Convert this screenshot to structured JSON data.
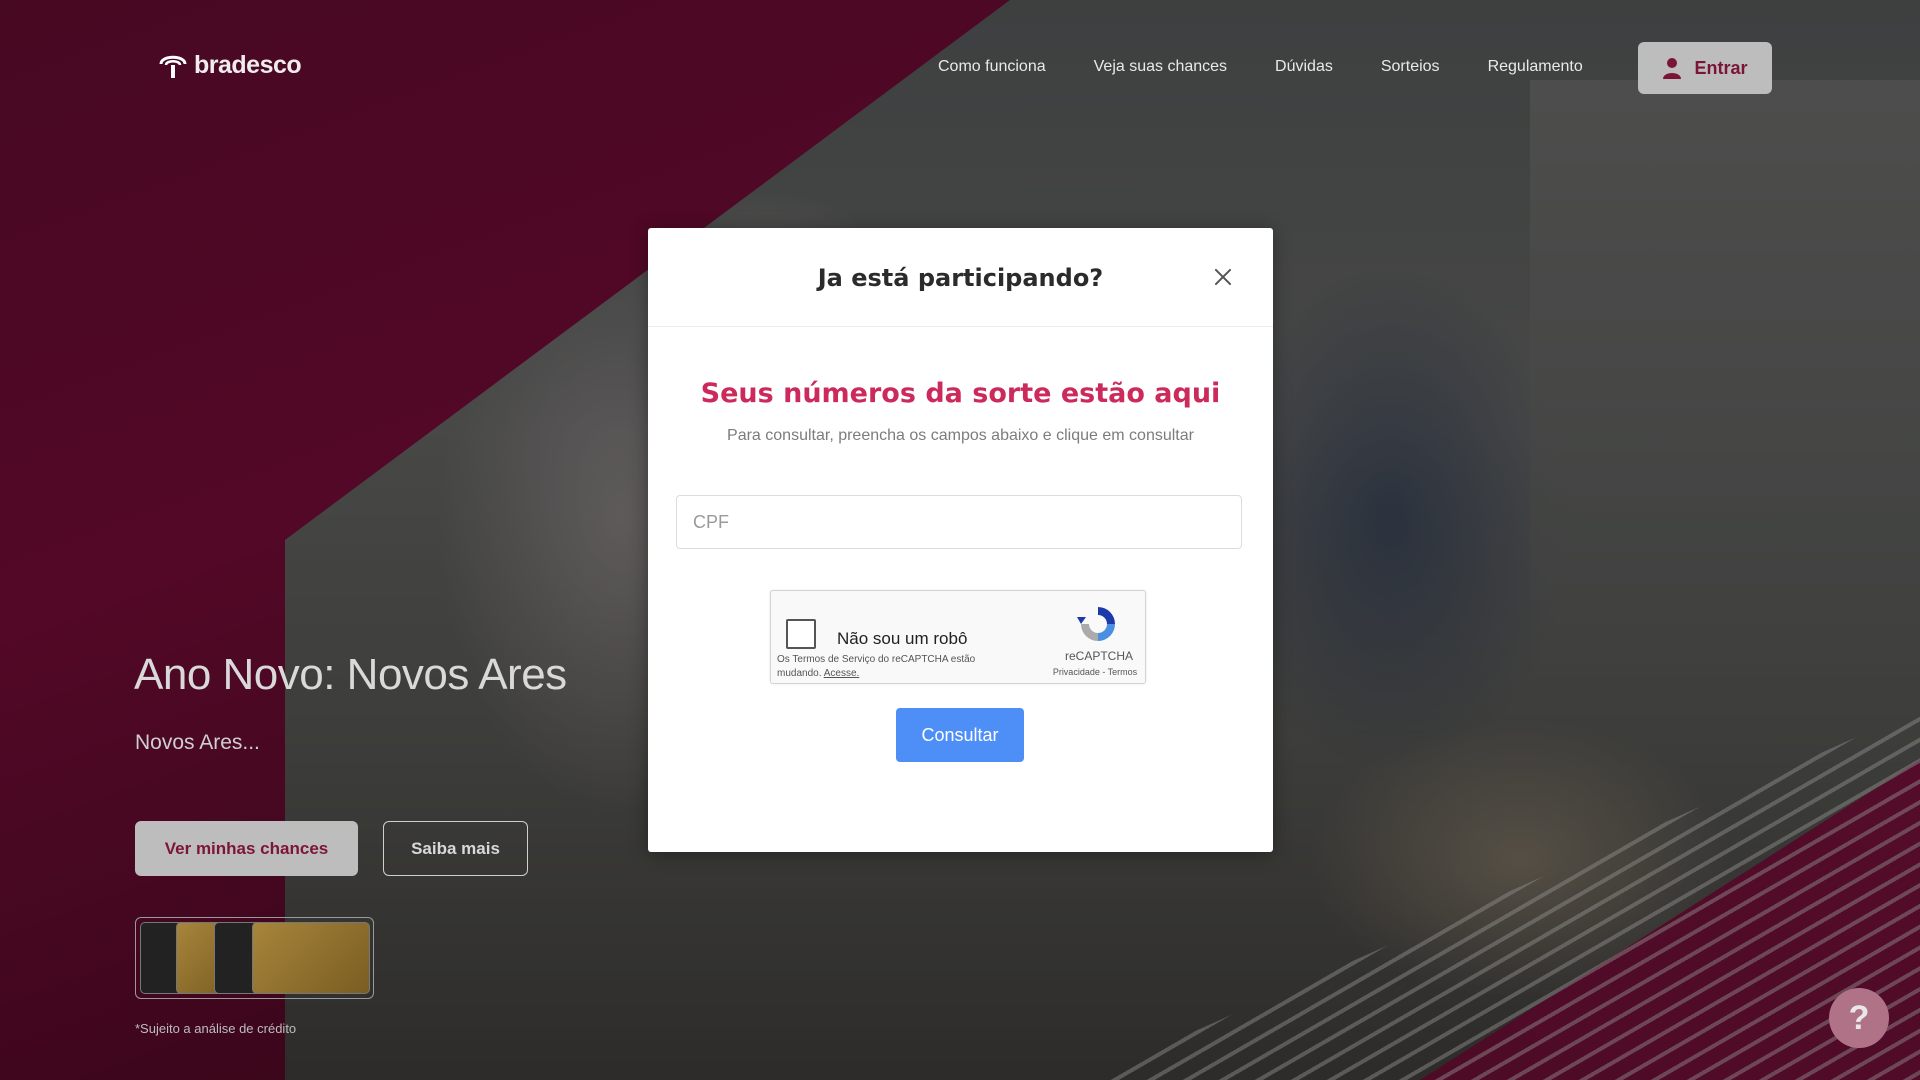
{
  "header": {
    "logo_text": "bradesco",
    "nav": [
      "Como funciona",
      "Veja suas chances",
      "Dúvidas",
      "Sorteios",
      "Regulamento"
    ],
    "login_label": "Entrar"
  },
  "hero": {
    "title": "Ano Novo: Novos Ares",
    "subtitle": "Novos Ares...",
    "primary_button": "Ver minhas chances",
    "secondary_button": "Saiba mais",
    "disclaimer": "*Sujeito a análise de crédito"
  },
  "help": {
    "label": "?"
  },
  "modal": {
    "title": "Ja está participando?",
    "headline": "Seus números da sorte estão aqui",
    "description": "Para consultar, preencha os campos abaixo e clique em consultar",
    "cpf_placeholder": "CPF",
    "cpf_value": "",
    "recaptcha": {
      "label": "Não sou um robô",
      "terms": "Os Termos de Serviço do reCAPTCHA estão mudando.",
      "terms_link": "Acesse.",
      "brand": "reCAPTCHA",
      "privacy": "Privacidade - Termos",
      "checked": false
    },
    "submit_label": "Consultar"
  },
  "colors": {
    "brand_magenta": "#cc2a5b",
    "background_magenta": "#8e0f43",
    "primary_blue": "#4e8ef7"
  },
  "icons": {
    "logo": "bradesco-tree-icon",
    "login": "user-icon",
    "close": "close-icon",
    "recaptcha": "recaptcha-icon",
    "help": "question-icon"
  }
}
